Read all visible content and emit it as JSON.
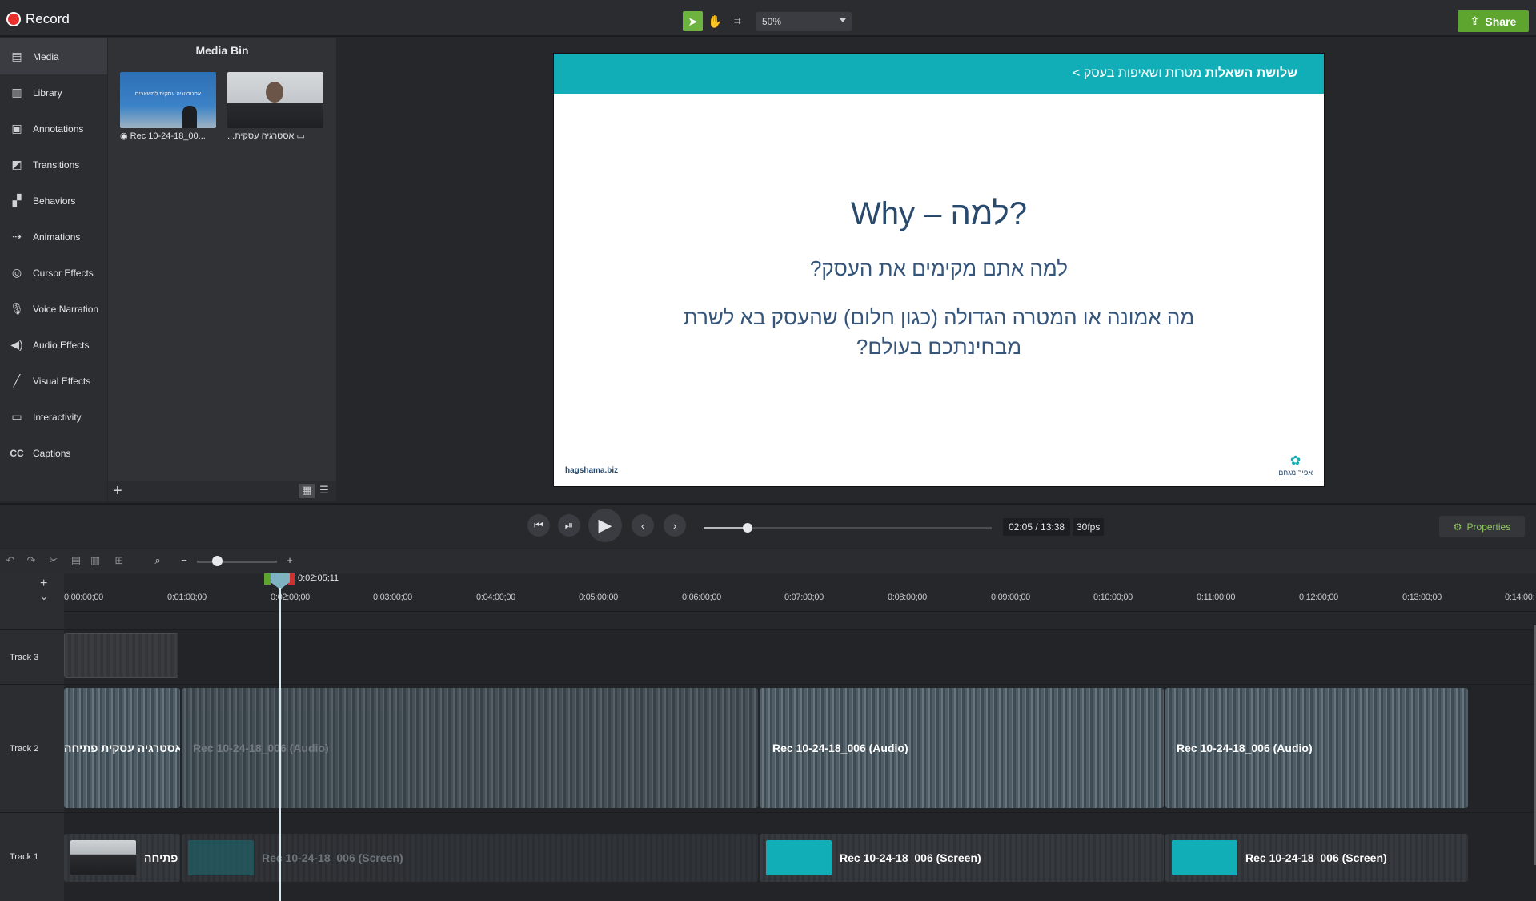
{
  "app": {
    "record_label": "Record",
    "share_label": "Share",
    "zoom_value": "50%"
  },
  "sidebar": {
    "items": [
      {
        "label": "Media",
        "icon": "film-icon"
      },
      {
        "label": "Library",
        "icon": "library-icon"
      },
      {
        "label": "Annotations",
        "icon": "annotation-icon"
      },
      {
        "label": "Transitions",
        "icon": "transition-icon"
      },
      {
        "label": "Behaviors",
        "icon": "behavior-icon"
      },
      {
        "label": "Animations",
        "icon": "animation-icon"
      },
      {
        "label": "Cursor Effects",
        "icon": "cursor-icon"
      },
      {
        "label": "Voice Narration",
        "icon": "microphone-icon"
      },
      {
        "label": "Audio Effects",
        "icon": "speaker-icon"
      },
      {
        "label": "Visual Effects",
        "icon": "wand-icon"
      },
      {
        "label": "Interactivity",
        "icon": "interactivity-icon"
      },
      {
        "label": "Captions",
        "icon": "cc-icon"
      }
    ]
  },
  "media_bin": {
    "title": "Media Bin",
    "items": [
      {
        "caption": "Rec 10-24-18_00...",
        "thumb_text": "אסטרטגיה עסקית למשאבים"
      },
      {
        "caption": "אסטרגיה עסקית..."
      }
    ]
  },
  "slide": {
    "crumb_prefix": "מטרות ושאיפות בעסק >",
    "crumb_current": "שלושת השאלות",
    "title": "Why – למה?",
    "question1": "למה אתם מקימים את העסק?",
    "question2": "מה אמונה או המטרה הגדולה (כגון חלום) שהעסק בא לשרת מבחינתכם בעולם?",
    "site": "hagshama.biz",
    "logo_text": "אפיר מגחם"
  },
  "playback": {
    "time": "02:05 / 13:38",
    "fps": "30fps",
    "progress": 0.153,
    "properties_label": "Properties"
  },
  "timeline": {
    "playhead_label": "0:02:05;11",
    "zoom_level": 0.25,
    "ruler": [
      "0:00:00;00",
      "0:01:00;00",
      "0:02:00;00",
      "0:03:00;00",
      "0:04:00;00",
      "0:05:00;00",
      "0:06:00;00",
      "0:07:00;00",
      "0:08:00;00",
      "0:09:00;00",
      "0:10:00;00",
      "0:11:00;00",
      "0:12:00;00",
      "0:13:00;00",
      "0:14:00;"
    ],
    "tracks": [
      {
        "label": "Track 3"
      },
      {
        "label": "Track 2"
      },
      {
        "label": "Track 1"
      }
    ],
    "track2_clips": [
      {
        "label": "אסטרגיה עסקית פתיחה"
      },
      {
        "label": "Rec 10-24-18_006 (Audio)"
      },
      {
        "label": "Rec 10-24-18_006 (Audio)"
      },
      {
        "label": "Rec 10-24-18_006 (Audio)"
      }
    ],
    "track1_clips": [
      {
        "label": "פתיחה"
      },
      {
        "label": "Rec 10-24-18_006 (Screen)"
      },
      {
        "label": "Rec 10-24-18_006 (Screen)"
      },
      {
        "label": "Rec 10-24-18_006 (Screen)"
      }
    ]
  }
}
